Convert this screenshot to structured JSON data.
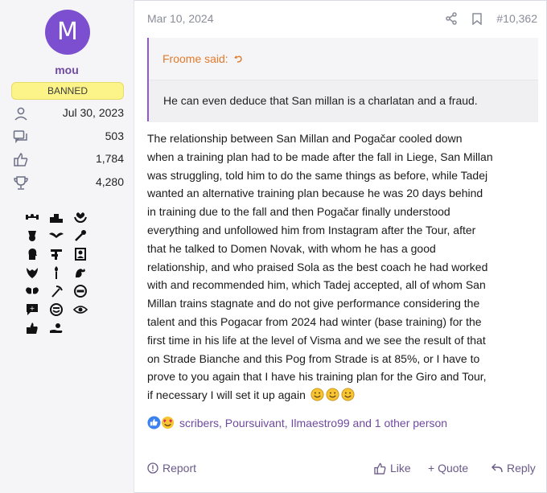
{
  "user": {
    "avatar_letter": "M",
    "avatar_color": "#7b4fcf",
    "name": "mou",
    "badge": "BANNED",
    "joined": "Jul 30, 2023",
    "messages": "503",
    "reactions": "1,784",
    "points": "4,280",
    "trophy_icons": [
      "weights-icon",
      "podium-icon",
      "heart-hands-icon",
      "medal-icon",
      "wings-icon",
      "trophy-hand-icon",
      "head-profile-icon",
      "signpost-icon",
      "portrait-frame-icon",
      "heart-hands-icon",
      "torch-icon",
      "flexing-arm-icon",
      "angel-wings-icon",
      "pickaxe-icon",
      "no-entry-icon",
      "speech-box-icon",
      "smiley-icon",
      "eye-icon",
      "thumbs-up-icon",
      "hand-give-icon"
    ]
  },
  "post": {
    "date": "Mar 10, 2024",
    "number": "#10,362",
    "quote_author": "Froome said:",
    "quote_text": "He can even deduce that San millan is a charlatan and a fraud.",
    "body_lines": [
      "The relationship between San Millan and Pogačar cooled down",
      "when a training plan had to be made after the fall in Liege, San Millan",
      "was struggling, told him to do the same things as before, while Tadej",
      "wanted an alternative training plan because he was 20 days behind",
      "in training due to the fall and then Pogačar finally understood",
      "everything and unfollowed him from Instagram after the Tour, after",
      "that he talked to Domen Novak, with whom he has a good",
      "relationship, and who praised Sola as the best coach he had worked",
      "with and recommended him, which Tadej accepted, all of whom San",
      "Millan trains stagnate and do not give performance considering the",
      "talent and this Pogacar from 2024 had winter (base training) for the",
      "first time in his life at the level of Visma and we see the result of that",
      "on Strade Bianche and this Pog from Strade is at 85%, or I have to",
      "prove to you again that I have his training plan for the Giro and Tour,",
      "if necessary I will set it up again"
    ],
    "reactions_text": "scribers, Poursuivant, Ilmaestro99 and 1 other person"
  },
  "actions": {
    "report": "Report",
    "like": "Like",
    "quote": "+ Quote",
    "reply": "Reply"
  },
  "colors": {
    "accent": "#6f4aa0",
    "quote_bar": "#9157d6",
    "quote_author": "#e17a2a",
    "banned_bg": "#fcf489"
  }
}
